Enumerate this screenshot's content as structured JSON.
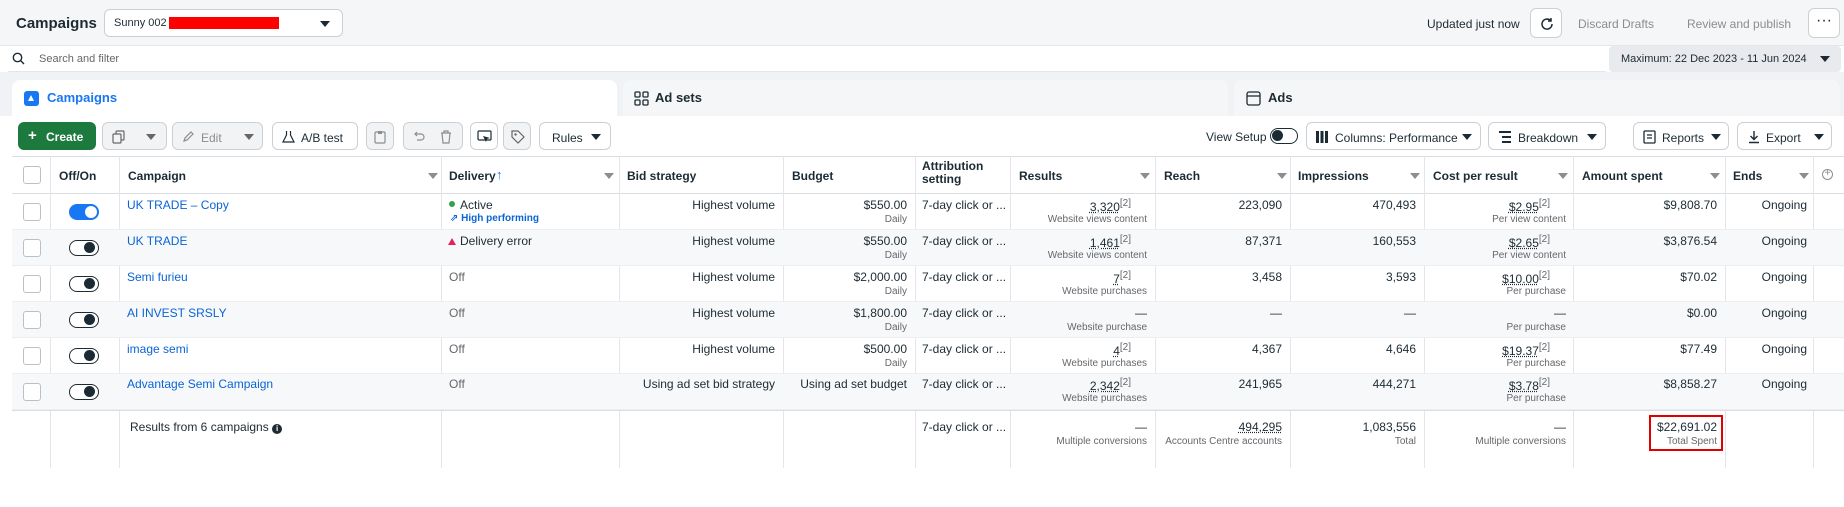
{
  "header": {
    "title": "Campaigns",
    "account": "Sunny 002",
    "updated": "Updated just now",
    "discard": "Discard Drafts",
    "review": "Review and publish",
    "more": "···"
  },
  "search": {
    "placeholder": "Search and filter",
    "date_range": "Maximum: 22 Dec 2023 - 11 Jun 2024"
  },
  "tabs": [
    {
      "label": "Campaigns"
    },
    {
      "label": "Ad sets"
    },
    {
      "label": "Ads"
    }
  ],
  "toolbar": {
    "create": "Create",
    "edit": "Edit",
    "ab_test": "A/B test",
    "rules": "Rules",
    "view_setup": "View Setup",
    "columns": "Columns: Performance",
    "breakdown": "Breakdown",
    "reports": "Reports",
    "export": "Export"
  },
  "columns": {
    "off_on": "Off/On",
    "campaign": "Campaign",
    "delivery": "Delivery",
    "bid": "Bid strategy",
    "budget": "Budget",
    "attribution": "Attribution setting",
    "results": "Results",
    "reach": "Reach",
    "impressions": "Impressions",
    "cpr": "Cost per result",
    "spent": "Amount spent",
    "ends": "Ends"
  },
  "rows": [
    {
      "name": "UK TRADE – Copy",
      "delivery": "Active",
      "badge": "High performing",
      "bid": "Highest volume",
      "budget": "$550.00",
      "budget_sub": "Daily",
      "attribution": "7-day click or ...",
      "results": "3,320",
      "results_sub": "Website views content",
      "reach": "223,090",
      "impressions": "470,493",
      "cpr": "$2.95",
      "cpr_sub": "Per view content",
      "spent": "$9,808.70",
      "ends": "Ongoing"
    },
    {
      "name": "UK TRADE",
      "delivery": "Delivery error",
      "bid": "Highest volume",
      "budget": "$550.00",
      "budget_sub": "Daily",
      "attribution": "7-day click or ...",
      "results": "1,461",
      "results_sub": "Website views content",
      "reach": "87,371",
      "impressions": "160,553",
      "cpr": "$2.65",
      "cpr_sub": "Per view content",
      "spent": "$3,876.54",
      "ends": "Ongoing"
    },
    {
      "name": "Semi furieu",
      "delivery": "Off",
      "bid": "Highest volume",
      "budget": "$2,000.00",
      "budget_sub": "Daily",
      "attribution": "7-day click or ...",
      "results": "7",
      "results_sub": "Website purchases",
      "reach": "3,458",
      "impressions": "3,593",
      "cpr": "$10.00",
      "cpr_sub": "Per purchase",
      "spent": "$70.02",
      "ends": "Ongoing"
    },
    {
      "name": "AI INVEST SRSLY",
      "delivery": "Off",
      "bid": "Highest volume",
      "budget": "$1,800.00",
      "budget_sub": "Daily",
      "attribution": "7-day click or ...",
      "results": "—",
      "results_sub": "Website purchase",
      "reach": "—",
      "impressions": "—",
      "cpr": "—",
      "cpr_sub": "Per purchase",
      "spent": "$0.00",
      "ends": "Ongoing"
    },
    {
      "name": "image semi",
      "delivery": "Off",
      "bid": "Highest volume",
      "budget": "$500.00",
      "budget_sub": "Daily",
      "attribution": "7-day click or ...",
      "results": "4",
      "results_sub": "Website purchases",
      "reach": "4,367",
      "impressions": "4,646",
      "cpr": "$19.37",
      "cpr_sub": "Per purchase",
      "spent": "$77.49",
      "ends": "Ongoing"
    },
    {
      "name": "Advantage Semi Campaign",
      "delivery": "Off",
      "bid": "Using ad set bid strategy",
      "budget": "Using ad set budget",
      "budget_sub": "",
      "attribution": "7-day click or ...",
      "results": "2,342",
      "results_sub": "Website purchases",
      "reach": "241,965",
      "impressions": "444,271",
      "cpr": "$3.78",
      "cpr_sub": "Per purchase",
      "spent": "$8,858.27",
      "ends": "Ongoing"
    }
  ],
  "totals": {
    "label": "Results from 6 campaigns",
    "attribution": "7-day click or ...",
    "results": "—",
    "results_sub": "Multiple conversions",
    "reach": "494,295",
    "reach_sub": "Accounts Centre accounts",
    "impressions": "1,083,556",
    "impressions_sub": "Total",
    "cpr": "—",
    "cpr_sub": "Multiple conversions",
    "spent": "$22,691.02",
    "spent_sub": "Total Spent"
  },
  "marks": {
    "results_sup": "[2]"
  },
  "colors": {
    "accent": "#1877f2",
    "create_green": "#1c7a3e",
    "active_dot": "#31a24c",
    "error": "#e0245e",
    "highlight_box": "#e00000"
  }
}
